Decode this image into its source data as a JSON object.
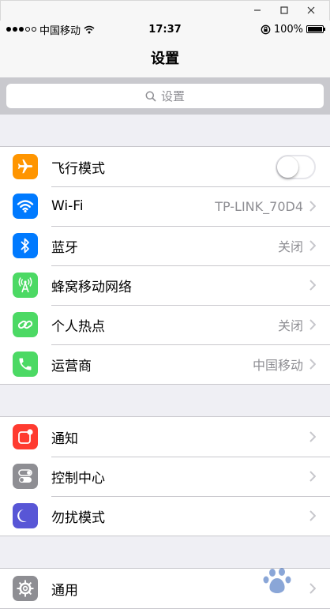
{
  "window": {
    "minimize_glyph": "–",
    "maximize_glyph": "☐",
    "close_glyph": "✕"
  },
  "status": {
    "carrier": "中国移动",
    "time": "17:37",
    "battery": "100%",
    "signal_bars_filled": 3,
    "signal_bars_total": 5
  },
  "nav": {
    "title": "设置"
  },
  "search": {
    "placeholder": "设置"
  },
  "groups": [
    {
      "rows": [
        {
          "label": "飞行模式",
          "icon": "airplane-icon",
          "color": "#ff9500",
          "type": "toggle",
          "toggle_on": false
        },
        {
          "label": "Wi-Fi",
          "icon": "wifi-icon",
          "color": "#007aff",
          "value": "TP-LINK_70D4"
        },
        {
          "label": "蓝牙",
          "icon": "bluetooth-icon",
          "color": "#007aff",
          "value": "关闭"
        },
        {
          "label": "蜂窝移动网络",
          "icon": "cellular-antenna-icon",
          "color": "#4cd964",
          "value": ""
        },
        {
          "label": "个人热点",
          "icon": "hotspot-icon",
          "color": "#4cd964",
          "value": "关闭"
        },
        {
          "label": "运营商",
          "icon": "phone-icon",
          "color": "#4cd964",
          "value": "中国移动"
        }
      ]
    },
    {
      "rows": [
        {
          "label": "通知",
          "icon": "notifications-icon",
          "color": "#ff3b30",
          "value": ""
        },
        {
          "label": "控制中心",
          "icon": "control-center-icon",
          "color": "#8e8e93",
          "value": ""
        },
        {
          "label": "勿扰模式",
          "icon": "moon-icon",
          "color": "#5856d6",
          "value": ""
        }
      ]
    },
    {
      "rows": [
        {
          "label": "通用",
          "icon": "gear-icon",
          "color": "#8e8e93",
          "value": ""
        }
      ]
    }
  ]
}
